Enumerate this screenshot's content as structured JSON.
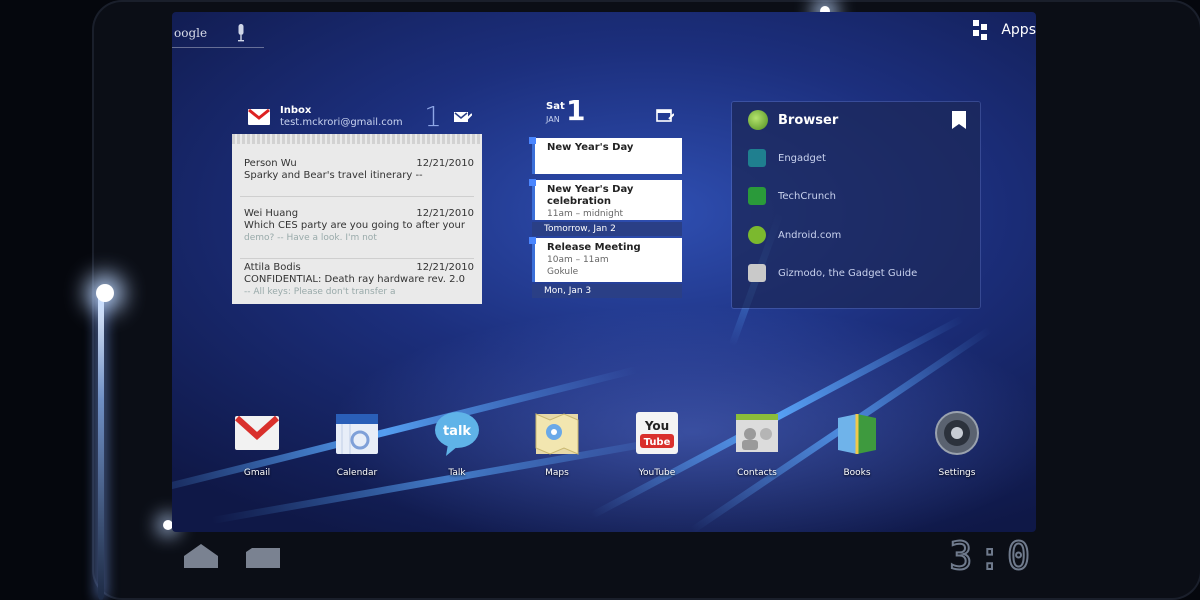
{
  "top_bar": {
    "search_logo": "oogle",
    "apps_label": "Apps"
  },
  "gmail_widget": {
    "title": "Inbox",
    "account": "test.mckrori@gmail.com",
    "count": "1",
    "messages": [
      {
        "sender": "Person Wu",
        "date": "12/21/2010",
        "subject": "Sparky and Bear's travel itinerary --",
        "snippet": ""
      },
      {
        "sender": "Wei Huang",
        "date": "12/21/2010",
        "subject": "Which CES party are you going to after your",
        "snippet": "demo? -- Have a look. I'm not"
      },
      {
        "sender": "Attila Bodis",
        "date": "12/21/2010",
        "subject": "CONFIDENTIAL: Death ray hardware rev. 2.0",
        "snippet": "-- All keys: Please don't transfer a"
      }
    ]
  },
  "calendar_widget": {
    "weekday": "Sat",
    "month": "JAN",
    "day": "1",
    "events": [
      {
        "title": "New Year's Day",
        "time": ""
      },
      {
        "title": "New Year's Day celebration",
        "time": "11am – midnight"
      },
      {
        "title": "Release Meeting",
        "time": "10am – 11am",
        "place": "Gokule"
      }
    ],
    "day_bars": [
      "Tomorrow, Jan 2",
      "Mon, Jan 3"
    ]
  },
  "browser_widget": {
    "title": "Browser",
    "bookmarks": [
      {
        "label": "Engadget",
        "color": "#1f7f8f"
      },
      {
        "label": "TechCrunch",
        "color": "#2a9a3a"
      },
      {
        "label": "Android.com",
        "color": "#7bb92e"
      },
      {
        "label": "Gizmodo, the Gadget Guide",
        "color": "#c9c9c9"
      }
    ]
  },
  "apps": [
    {
      "label": "Gmail",
      "icon": "gmail-icon"
    },
    {
      "label": "Calendar",
      "icon": "calendar-icon"
    },
    {
      "label": "Talk",
      "icon": "talk-icon"
    },
    {
      "label": "Maps",
      "icon": "maps-icon"
    },
    {
      "label": "YouTube",
      "icon": "youtube-icon"
    },
    {
      "label": "Contacts",
      "icon": "contacts-icon"
    },
    {
      "label": "Books",
      "icon": "books-icon"
    },
    {
      "label": "Settings",
      "icon": "settings-icon"
    }
  ],
  "app_icon_text": {
    "talk": "talk",
    "youtube_top": "You",
    "youtube_bottom": "Tube"
  },
  "version_badge": "3:0"
}
